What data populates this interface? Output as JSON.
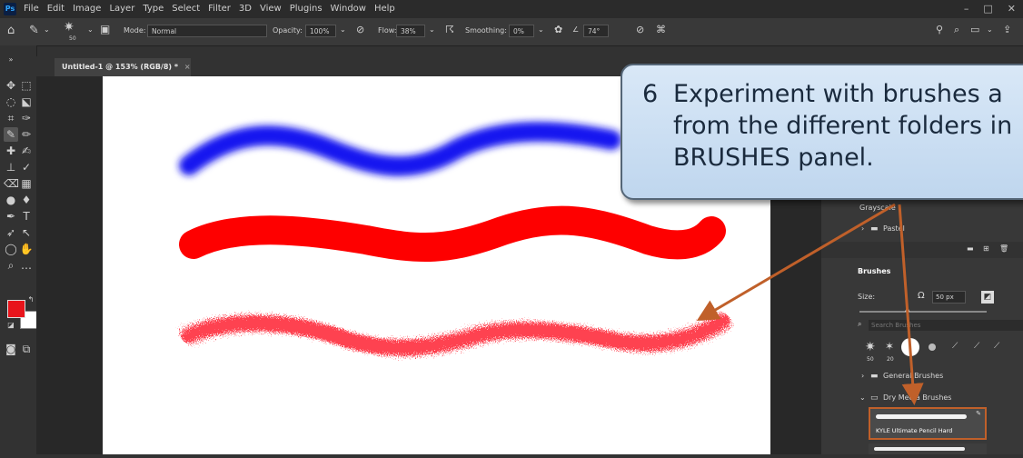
{
  "app": {
    "logo": "Ps",
    "menus": [
      "File",
      "Edit",
      "Image",
      "Layer",
      "Type",
      "Select",
      "Filter",
      "3D",
      "View",
      "Plugins",
      "Window",
      "Help"
    ],
    "window_controls": [
      "–",
      "□",
      "✕"
    ]
  },
  "options": {
    "brush_size": "50",
    "mode_label": "Mode:",
    "mode_value": "Normal",
    "opacity_label": "Opacity:",
    "opacity_value": "100%",
    "flow_label": "Flow:",
    "flow_value": "38%",
    "smoothing_label": "Smoothing:",
    "smoothing_value": "0%",
    "angle_value": "74°"
  },
  "document": {
    "tab_title": "Untitled-1 @ 153% (RGB/8) *",
    "tab_close": "×"
  },
  "colors": {
    "fg": "#e8141b",
    "bg": "#ffffff",
    "stroke_blue": "#1515f0",
    "stroke_red": "#fe0000",
    "callout_accent": "#c0602a"
  },
  "panel": {
    "folder_grayscale": "Grayscale",
    "folder_pastel": "Pastel",
    "brushes_title": "Brushes",
    "size_label": "Size:",
    "size_value": "50 px",
    "search_placeholder": "Search Brushes",
    "recent_sizes": [
      "50",
      "20"
    ],
    "folder_general": "General Brushes",
    "folder_dry_media": "Dry Media Brushes",
    "selected_brush": "KYLE Ultimate Pencil Hard"
  },
  "callout": {
    "number": "6",
    "lines": [
      "Experiment with brushes a",
      "from the different folders in",
      "BRUSHES panel."
    ]
  }
}
